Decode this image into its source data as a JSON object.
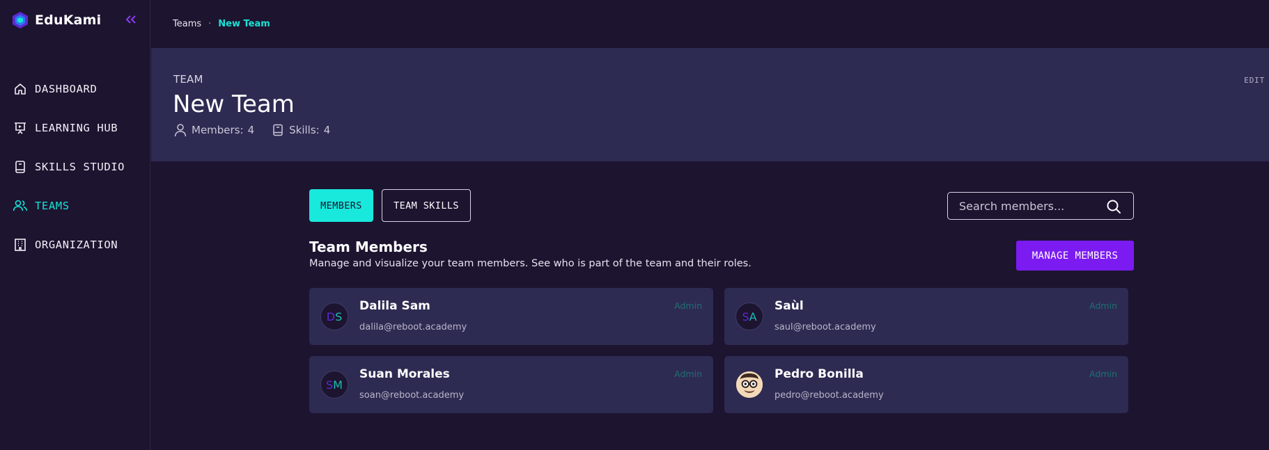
{
  "brand": {
    "name": "EduKami",
    "accent": "#7b1bf2",
    "cyan": "#19e3d5"
  },
  "sidebar": {
    "items": [
      {
        "label": "DASHBOARD",
        "icon": "home-icon",
        "active": false
      },
      {
        "label": "LEARNING HUB",
        "icon": "presentation-icon",
        "active": false
      },
      {
        "label": "SKILLS STUDIO",
        "icon": "book-icon",
        "active": false
      },
      {
        "label": "TEAMS",
        "icon": "users-icon",
        "active": true
      },
      {
        "label": "ORGANIZATION",
        "icon": "building-icon",
        "active": false
      }
    ]
  },
  "breadcrumb": {
    "parent": "Teams",
    "separator": "·",
    "current": "New Team"
  },
  "header": {
    "kicker": "TEAM",
    "title": "New Team",
    "members_label": "Members:",
    "members_count": "4",
    "skills_label": "Skills:",
    "skills_count": "4",
    "edit_label": "EDIT"
  },
  "tabs": {
    "members": "MEMBERS",
    "team_skills": "TEAM SKILLS"
  },
  "search": {
    "placeholder": "Search members..."
  },
  "section": {
    "title": "Team Members",
    "description": "Manage and visualize your team members. See who is part of the team and their roles."
  },
  "manage_button": "MANAGE MEMBERS",
  "members": [
    {
      "initial1": "D",
      "initial2": "S",
      "name": "Dalila Sam",
      "email": "dalila@reboot.academy",
      "role": "Admin"
    },
    {
      "initial1": "S",
      "initial2": "A",
      "name": "Saùl",
      "email": "saul@reboot.academy",
      "role": "Admin"
    },
    {
      "initial1": "S",
      "initial2": "M",
      "name": "Suan Morales",
      "email": "soan@reboot.academy",
      "role": "Admin"
    },
    {
      "name": "Pedro Bonilla",
      "email": "pedro@reboot.academy",
      "role": "Admin"
    }
  ]
}
